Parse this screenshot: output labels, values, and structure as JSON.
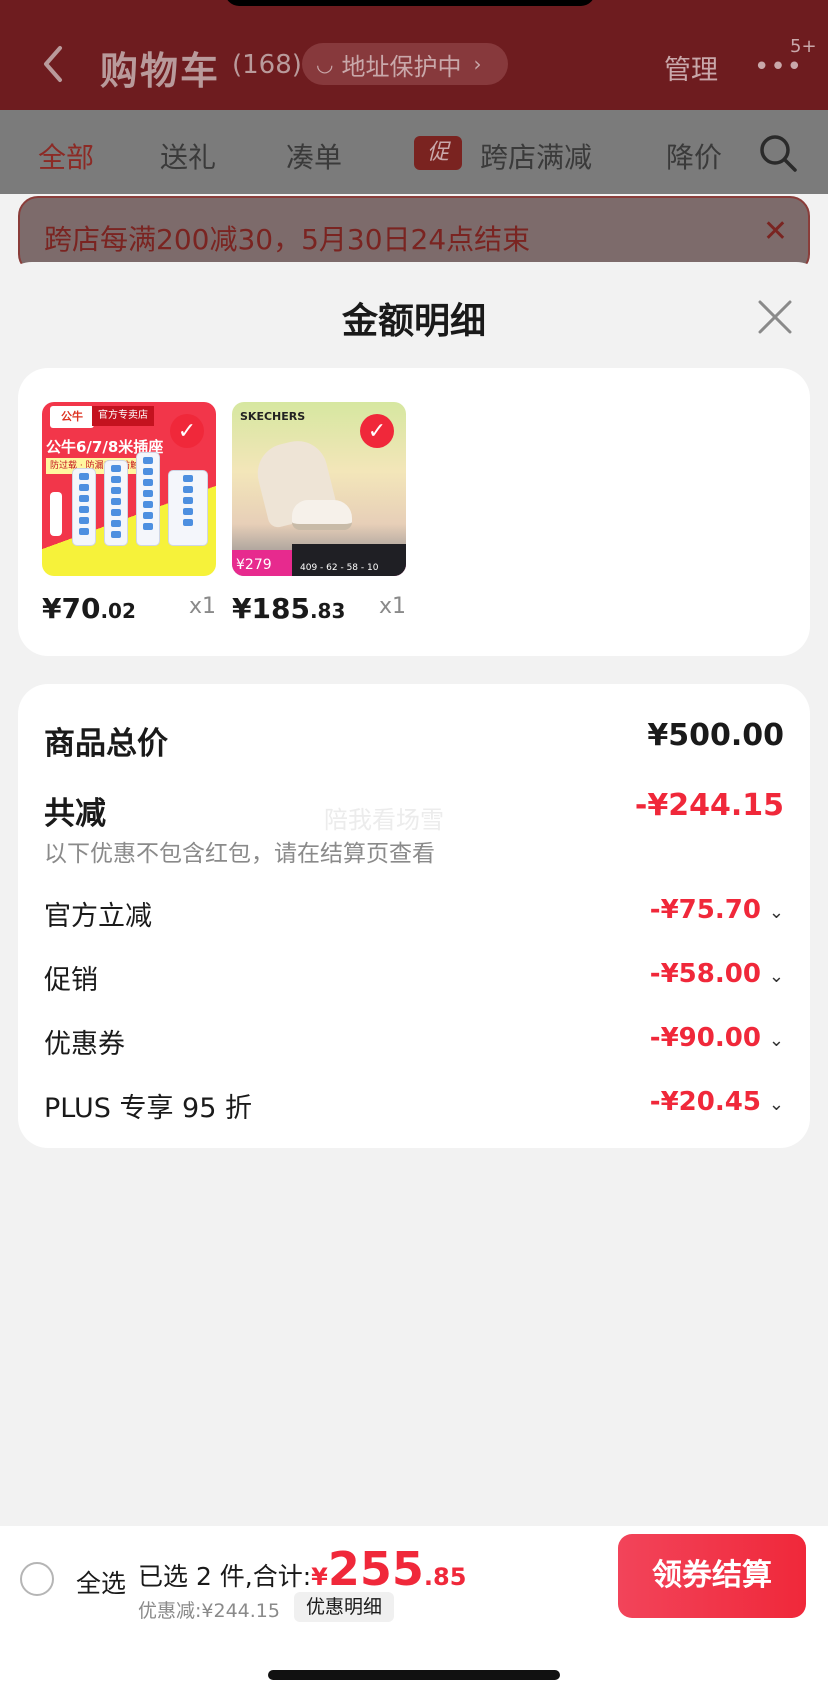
{
  "header": {
    "title": "购物车",
    "count": "(168)",
    "address_pill": "地址保护中",
    "manage": "管理",
    "notification_badge": "5+"
  },
  "tabs": [
    {
      "label": "全部",
      "active": true
    },
    {
      "label": "送礼"
    },
    {
      "label": "凑单"
    },
    {
      "label": "跨店满减",
      "tag": "促"
    },
    {
      "label": "降价"
    }
  ],
  "notice": {
    "text": "跨店每满200减30，5月30日24点结束"
  },
  "sheet": {
    "title": "金额明细",
    "products": [
      {
        "price_int": "¥70",
        "price_dec": ".02",
        "qty": "x1",
        "image": {
          "logo": "公牛",
          "store": "官方专卖店",
          "headline": "公牛6/7/8米插座",
          "sub": "防过载 · 防漏电 · 防触电"
        }
      },
      {
        "price_int": "¥185",
        "price_dec": ".83",
        "qty": "x1",
        "image": {
          "brand": "SKECHERS",
          "price_tag": "279",
          "promo": "409 - 62 - 58 - 10"
        }
      }
    ],
    "watermark": "陪我看场雪",
    "total_label": "商品总价",
    "total_value": "¥500.00",
    "reduce_label": "共减",
    "reduce_value": "-¥244.15",
    "reduce_hint": "以下优惠不包含红包，请在结算页查看",
    "discounts": [
      {
        "label": "官方立减",
        "value": "-¥75.70"
      },
      {
        "label": "促销",
        "value": "-¥58.00"
      },
      {
        "label": "优惠券",
        "value": "-¥90.00"
      },
      {
        "label": "PLUS 专享 95 折",
        "value": "-¥20.45"
      }
    ]
  },
  "bottom_bar": {
    "select_all": "全选",
    "selected_summary": "已选 2 件,合计:",
    "total_symbol": "¥",
    "total_int": "255",
    "total_dec": ".85",
    "saved": "优惠减:¥244.15",
    "detail_button": "优惠明细",
    "checkout_button": "领券结算"
  },
  "colors": {
    "accent_red": "#f0283a",
    "header_dim": "#6e1c1f"
  }
}
